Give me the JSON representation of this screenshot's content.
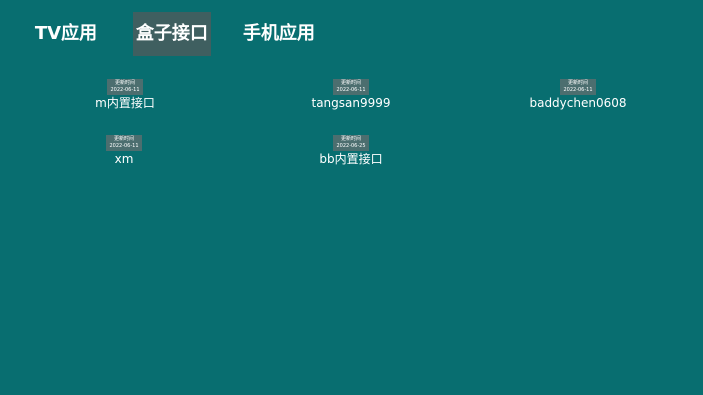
{
  "tabs": [
    {
      "label": "TV应用",
      "selected": false
    },
    {
      "label": "盒子接口",
      "selected": true
    },
    {
      "label": "手机应用",
      "selected": false
    }
  ],
  "items": [
    {
      "update_label": "更新时间",
      "date": "2022-06-11",
      "name": "m内置接口"
    },
    {
      "update_label": "更新时间",
      "date": "2022-06-11",
      "name": "tangsan9999"
    },
    {
      "update_label": "更新时间",
      "date": "2022-06-11",
      "name": "baddychen0608"
    },
    {
      "update_label": "更新时间",
      "date": "2022-06-11",
      "name": "xm"
    },
    {
      "update_label": "更新时间",
      "date": "2022-06-25",
      "name": "bb内置接口"
    }
  ],
  "colors": {
    "background": "#086e70",
    "selected_tab": "#3f5f60",
    "badge": "#4c6e6f"
  }
}
